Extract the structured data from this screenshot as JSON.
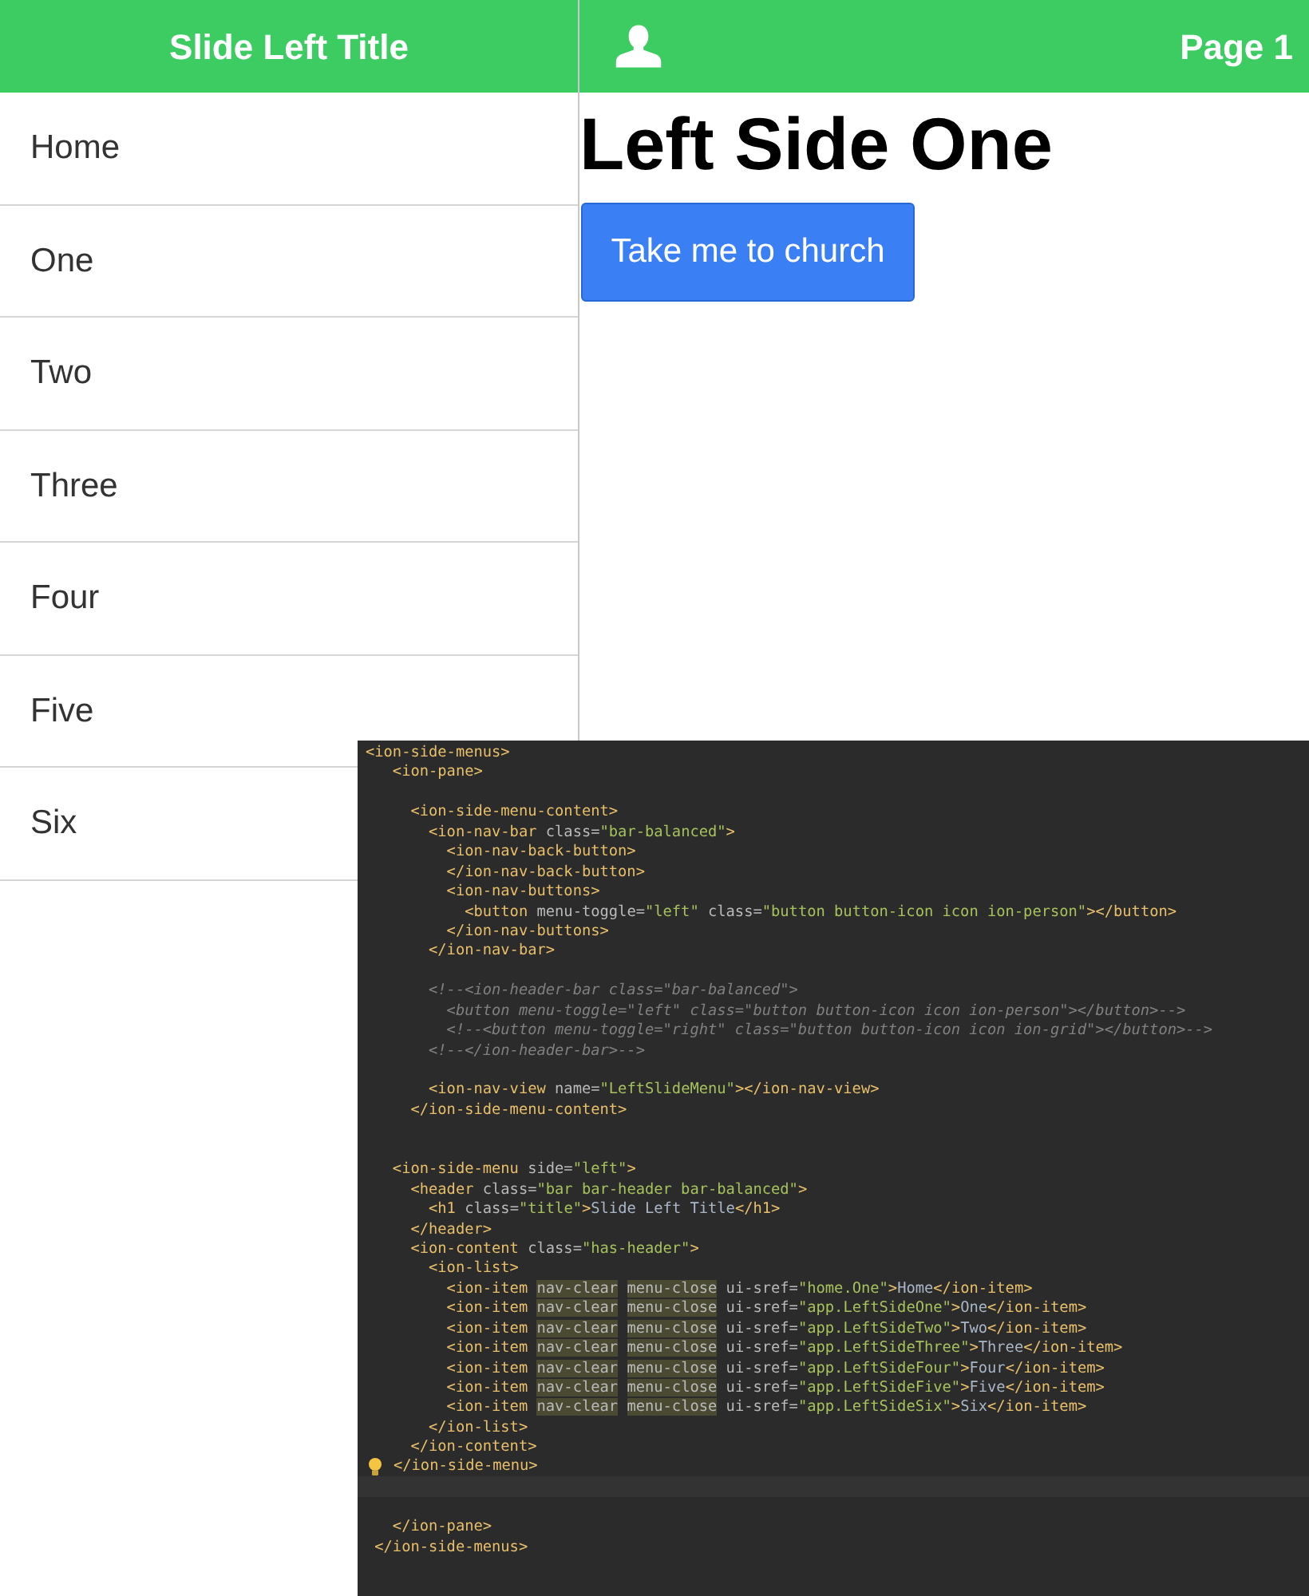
{
  "menu": {
    "title": "Slide Left Title",
    "items": [
      "Home",
      "One",
      "Two",
      "Three",
      "Four",
      "Five",
      "Six"
    ]
  },
  "nav_bar": {
    "title": "Page 1"
  },
  "content": {
    "heading": "Left Side One",
    "button": "Take me to church"
  },
  "editor": {
    "lines": [
      {
        "kind": "code",
        "tokens": [
          {
            "kind": "tag",
            "text": "<ion-side-menus>"
          }
        ]
      },
      {
        "kind": "code",
        "tokens": [
          {
            "kind": "tag",
            "text": "   <ion-pane>"
          }
        ]
      },
      {
        "kind": "blank"
      },
      {
        "kind": "code",
        "tokens": [
          {
            "kind": "tag",
            "text": "     <ion-side-menu-content>"
          }
        ]
      },
      {
        "kind": "code",
        "tokens": [
          {
            "kind": "tag",
            "text": "       <ion-nav-bar"
          },
          {
            "kind": "attr",
            "text": " class="
          },
          {
            "kind": "str",
            "text": "\"bar-balanced\""
          },
          {
            "kind": "tag",
            "text": ">"
          }
        ]
      },
      {
        "kind": "code",
        "tokens": [
          {
            "kind": "tag",
            "text": "         <ion-nav-back-button>"
          }
        ]
      },
      {
        "kind": "code",
        "tokens": [
          {
            "kind": "tag",
            "text": "         </ion-nav-back-button>"
          }
        ]
      },
      {
        "kind": "code",
        "tokens": [
          {
            "kind": "tag",
            "text": "         <ion-nav-buttons>"
          }
        ]
      },
      {
        "kind": "code",
        "tokens": [
          {
            "kind": "tag",
            "text": "           <button"
          },
          {
            "kind": "attr",
            "text": " menu-toggle="
          },
          {
            "kind": "str",
            "text": "\"left\""
          },
          {
            "kind": "attr",
            "text": " class="
          },
          {
            "kind": "str",
            "text": "\"button button-icon icon ion-person\""
          },
          {
            "kind": "tag",
            "text": "></button>"
          }
        ]
      },
      {
        "kind": "code",
        "tokens": [
          {
            "kind": "tag",
            "text": "         </ion-nav-buttons>"
          }
        ]
      },
      {
        "kind": "code",
        "tokens": [
          {
            "kind": "tag",
            "text": "       </ion-nav-bar>"
          }
        ]
      },
      {
        "kind": "blank"
      },
      {
        "kind": "code",
        "tokens": [
          {
            "kind": "comment",
            "text": "       <!--<ion-header-bar class=\"bar-balanced\">"
          }
        ]
      },
      {
        "kind": "code",
        "tokens": [
          {
            "kind": "comment",
            "text": "         <button menu-toggle=\"left\" class=\"button button-icon icon ion-person\"></button>-->"
          }
        ]
      },
      {
        "kind": "code",
        "tokens": [
          {
            "kind": "comment",
            "text": "         <!--<button menu-toggle=\"right\" class=\"button button-icon icon ion-grid\"></button>-->"
          }
        ]
      },
      {
        "kind": "code",
        "tokens": [
          {
            "kind": "comment",
            "text": "       <!--</ion-header-bar>-->"
          }
        ]
      },
      {
        "kind": "blank"
      },
      {
        "kind": "code",
        "tokens": [
          {
            "kind": "tag",
            "text": "       <ion-nav-view"
          },
          {
            "kind": "attr",
            "text": " name="
          },
          {
            "kind": "str",
            "text": "\"LeftSlideMenu\""
          },
          {
            "kind": "tag",
            "text": "></ion-nav-view>"
          }
        ]
      },
      {
        "kind": "code",
        "tokens": [
          {
            "kind": "tag",
            "text": "     </ion-side-menu-content>"
          }
        ]
      },
      {
        "kind": "blank"
      },
      {
        "kind": "blank"
      },
      {
        "kind": "code",
        "tokens": [
          {
            "kind": "tag",
            "text": "   <ion-side-menu"
          },
          {
            "kind": "attr",
            "text": " side="
          },
          {
            "kind": "str",
            "text": "\"left\""
          },
          {
            "kind": "tag",
            "text": ">"
          }
        ]
      },
      {
        "kind": "code",
        "tokens": [
          {
            "kind": "tag",
            "text": "     <header"
          },
          {
            "kind": "attr",
            "text": " class="
          },
          {
            "kind": "str",
            "text": "\"bar bar-header bar-balanced\""
          },
          {
            "kind": "tag",
            "text": ">"
          }
        ]
      },
      {
        "kind": "code",
        "tokens": [
          {
            "kind": "tag",
            "text": "       <h1"
          },
          {
            "kind": "attr",
            "text": " class="
          },
          {
            "kind": "str",
            "text": "\"title\""
          },
          {
            "kind": "tag",
            "text": ">"
          },
          {
            "kind": "text",
            "text": "Slide Left Title"
          },
          {
            "kind": "tag",
            "text": "</h1>"
          }
        ]
      },
      {
        "kind": "code",
        "tokens": [
          {
            "kind": "tag",
            "text": "     </header>"
          }
        ]
      },
      {
        "kind": "code",
        "tokens": [
          {
            "kind": "tag",
            "text": "     <ion-content"
          },
          {
            "kind": "attr",
            "text": " class="
          },
          {
            "kind": "str",
            "text": "\"has-header\""
          },
          {
            "kind": "tag",
            "text": ">"
          }
        ]
      },
      {
        "kind": "code",
        "tokens": [
          {
            "kind": "tag",
            "text": "       <ion-list>"
          }
        ]
      },
      {
        "kind": "code",
        "tokens": [
          {
            "kind": "tag",
            "text": "         <ion-item"
          },
          {
            "kind": "mark",
            "text": "nav-clear"
          },
          {
            "kind": "mark",
            "text": "menu-close"
          },
          {
            "kind": "attr",
            "text": " ui-sref="
          },
          {
            "kind": "str",
            "text": "\"home.One\""
          },
          {
            "kind": "tag",
            "text": ">"
          },
          {
            "kind": "text",
            "text": "Home"
          },
          {
            "kind": "tag",
            "text": "</ion-item>"
          }
        ]
      },
      {
        "kind": "code",
        "tokens": [
          {
            "kind": "tag",
            "text": "         <ion-item"
          },
          {
            "kind": "mark",
            "text": "nav-clear"
          },
          {
            "kind": "mark",
            "text": "menu-close"
          },
          {
            "kind": "attr",
            "text": " ui-sref="
          },
          {
            "kind": "str",
            "text": "\"app.LeftSideOne\""
          },
          {
            "kind": "tag",
            "text": ">"
          },
          {
            "kind": "text",
            "text": "One"
          },
          {
            "kind": "tag",
            "text": "</ion-item>"
          }
        ]
      },
      {
        "kind": "code",
        "tokens": [
          {
            "kind": "tag",
            "text": "         <ion-item"
          },
          {
            "kind": "mark",
            "text": "nav-clear"
          },
          {
            "kind": "mark",
            "text": "menu-close"
          },
          {
            "kind": "attr",
            "text": " ui-sref="
          },
          {
            "kind": "str",
            "text": "\"app.LeftSideTwo\""
          },
          {
            "kind": "tag",
            "text": ">"
          },
          {
            "kind": "text",
            "text": "Two"
          },
          {
            "kind": "tag",
            "text": "</ion-item>"
          }
        ]
      },
      {
        "kind": "code",
        "tokens": [
          {
            "kind": "tag",
            "text": "         <ion-item"
          },
          {
            "kind": "mark",
            "text": "nav-clear"
          },
          {
            "kind": "mark",
            "text": "menu-close"
          },
          {
            "kind": "attr",
            "text": " ui-sref="
          },
          {
            "kind": "str",
            "text": "\"app.LeftSideThree\""
          },
          {
            "kind": "tag",
            "text": ">"
          },
          {
            "kind": "text",
            "text": "Three"
          },
          {
            "kind": "tag",
            "text": "</ion-item>"
          }
        ]
      },
      {
        "kind": "code",
        "tokens": [
          {
            "kind": "tag",
            "text": "         <ion-item"
          },
          {
            "kind": "mark",
            "text": "nav-clear"
          },
          {
            "kind": "mark",
            "text": "menu-close"
          },
          {
            "kind": "attr",
            "text": " ui-sref="
          },
          {
            "kind": "str",
            "text": "\"app.LeftSideFour\""
          },
          {
            "kind": "tag",
            "text": ">"
          },
          {
            "kind": "text",
            "text": "Four"
          },
          {
            "kind": "tag",
            "text": "</ion-item>"
          }
        ]
      },
      {
        "kind": "code",
        "tokens": [
          {
            "kind": "tag",
            "text": "         <ion-item"
          },
          {
            "kind": "mark",
            "text": "nav-clear"
          },
          {
            "kind": "mark",
            "text": "menu-close"
          },
          {
            "kind": "attr",
            "text": " ui-sref="
          },
          {
            "kind": "str",
            "text": "\"app.LeftSideFive\""
          },
          {
            "kind": "tag",
            "text": ">"
          },
          {
            "kind": "text",
            "text": "Five"
          },
          {
            "kind": "tag",
            "text": "</ion-item>"
          }
        ]
      },
      {
        "kind": "code",
        "tokens": [
          {
            "kind": "tag",
            "text": "         <ion-item"
          },
          {
            "kind": "mark",
            "text": "nav-clear"
          },
          {
            "kind": "mark",
            "text": "menu-close"
          },
          {
            "kind": "attr",
            "text": " ui-sref="
          },
          {
            "kind": "str",
            "text": "\"app.LeftSideSix\""
          },
          {
            "kind": "tag",
            "text": ">"
          },
          {
            "kind": "text",
            "text": "Six"
          },
          {
            "kind": "tag",
            "text": "</ion-item>"
          }
        ]
      },
      {
        "kind": "code",
        "tokens": [
          {
            "kind": "tag",
            "text": "       </ion-list>"
          }
        ]
      },
      {
        "kind": "code",
        "tokens": [
          {
            "kind": "tag",
            "text": "     </ion-content>"
          }
        ]
      },
      {
        "kind": "hinted",
        "tokens": [
          {
            "kind": "tag",
            "text": "</ion-side-menu>"
          }
        ]
      },
      {
        "kind": "cursor"
      },
      {
        "kind": "blank"
      },
      {
        "kind": "code",
        "tokens": [
          {
            "kind": "tag",
            "text": "   </ion-pane>"
          }
        ]
      },
      {
        "kind": "code",
        "tokens": [
          {
            "kind": "tag",
            "text": " </ion-side-menus>"
          }
        ]
      }
    ]
  }
}
